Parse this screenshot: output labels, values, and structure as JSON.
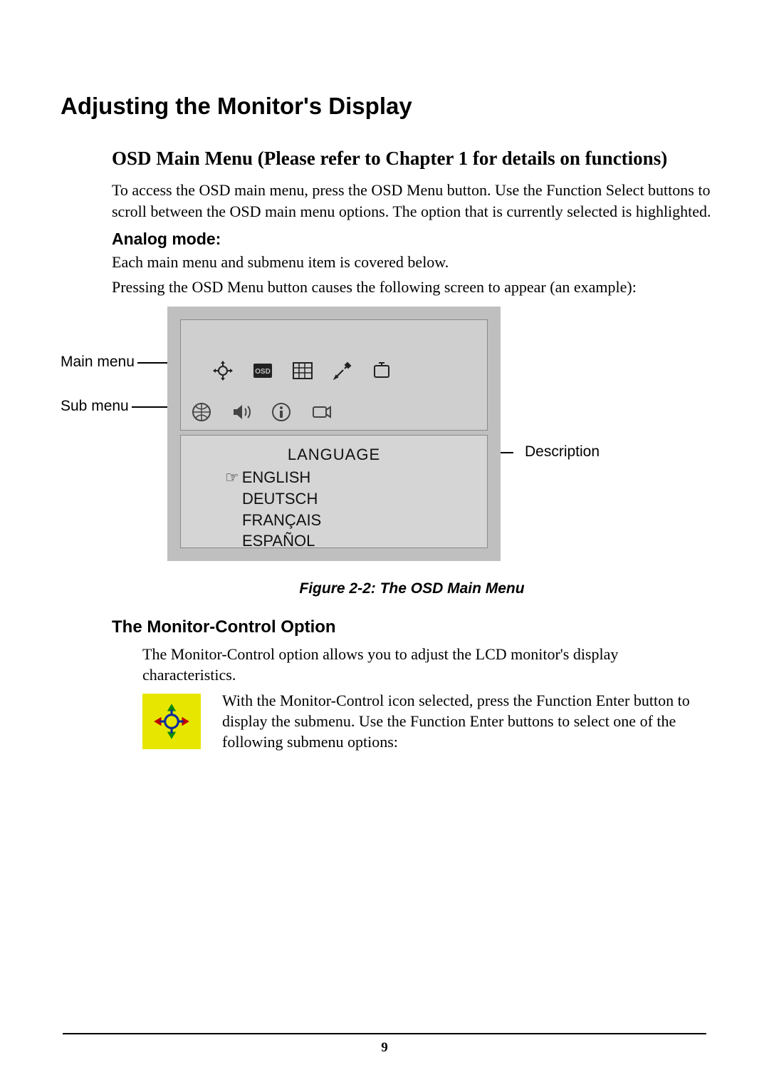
{
  "title": "Adjusting the Monitor's Display",
  "section1": {
    "heading": "OSD Main Menu (Please refer to Chapter 1 for details on functions)",
    "para": "To access the OSD main menu, press the OSD Menu button. Use the Function Select buttons to scroll between the OSD main menu options. The option that is currently selected is highlighted."
  },
  "analog": {
    "heading": "Analog mode:",
    "p1": "Each main menu and submenu item is covered below.",
    "p2": "Pressing the OSD Menu button causes the following screen to appear (an example):"
  },
  "callouts": {
    "main_menu": "Main menu",
    "sub_menu": "Sub menu",
    "description": "Description"
  },
  "osd": {
    "language_label": "LANGUAGE",
    "languages": [
      "ENGLISH",
      "DEUTSCH",
      "FRANÇAIS",
      "ESPAÑOL"
    ],
    "selected_index": 0,
    "main_icons": [
      "monitor-control",
      "osd",
      "display-grid",
      "tools",
      "other"
    ],
    "sub_icons": [
      "language-globe",
      "volume",
      "info",
      "recall"
    ]
  },
  "figure_caption": "Figure 2-2: The OSD Main Menu",
  "monitor_control": {
    "heading": "The Monitor-Control Option",
    "intro": "The Monitor-Control option allows you to adjust the LCD monitor's display characteristics.",
    "body": "With the Monitor-Control icon selected, press the Function Enter button to display the submenu. Use the Function Enter buttons to select one of the following submenu options:"
  },
  "page_number": "9"
}
